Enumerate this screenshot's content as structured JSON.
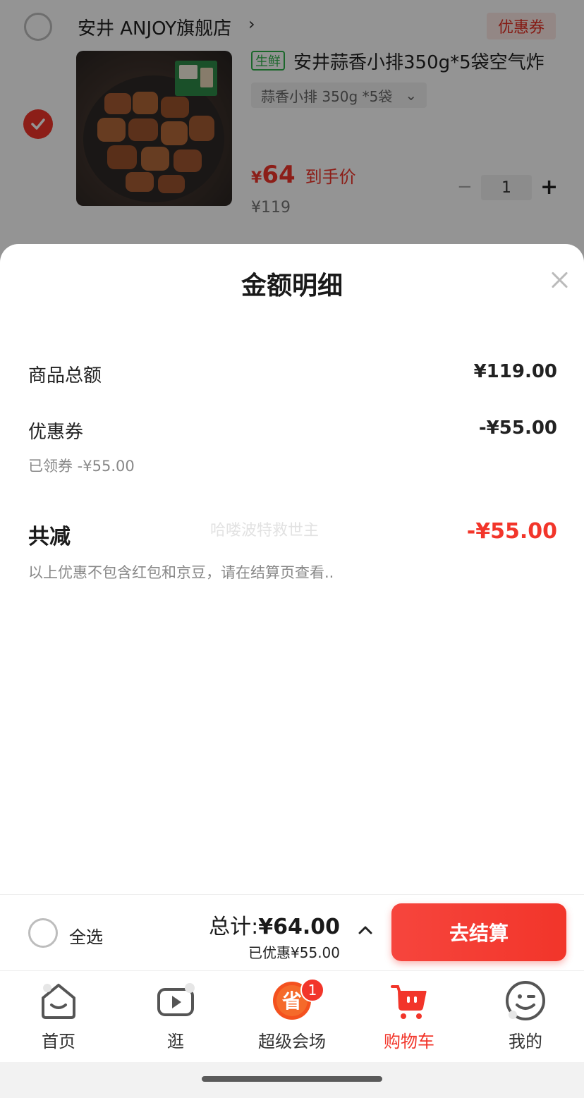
{
  "cart": {
    "shop_name": "安井 ANJOY旗舰店",
    "shop_arrow": "›",
    "coupon_tag": "优惠券",
    "fresh_tag": "生鲜",
    "product_title": "安井蒜香小排350g*5袋空气炸",
    "spec": "蒜香小排 350g *5袋",
    "spec_chevron": "⌄",
    "price_yen": "¥",
    "price_value": "64",
    "price_label": "到手价",
    "original_price": "¥119",
    "quantity": "1",
    "qty_minus": "−",
    "qty_plus": "+"
  },
  "sheet": {
    "title": "金额明细",
    "rows": [
      {
        "label": "商品总额",
        "value": "¥119.00"
      },
      {
        "label": "优惠券",
        "value": "-¥55.00",
        "sub": "已领券 -¥55.00"
      }
    ],
    "total_label": "共减",
    "total_value": "-¥55.00",
    "note": "以上优惠不包含红包和京豆，请在结算页查看..",
    "watermark": "哈喽波特救世主"
  },
  "checkout": {
    "select_all": "全选",
    "total_prefix": "总计:",
    "total_amount": "¥64.00",
    "saved": "已优惠¥55.00",
    "button": "去结算"
  },
  "tabs": [
    {
      "label": "首页",
      "icon": "home-icon"
    },
    {
      "label": "逛",
      "icon": "video-icon"
    },
    {
      "label": "超级会场",
      "icon": "super-venue-icon",
      "badge": "1",
      "icon_text": "省"
    },
    {
      "label": "购物车",
      "icon": "cart-icon",
      "active": true
    },
    {
      "label": "我的",
      "icon": "profile-icon"
    }
  ],
  "colors": {
    "accent": "#f2352a",
    "fresh": "#2fb24a",
    "overlay": "rgba(0,0,0,0.42)"
  }
}
